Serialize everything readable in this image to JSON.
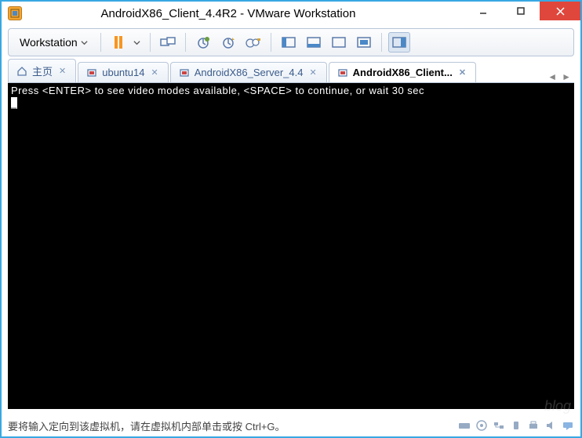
{
  "window": {
    "title": "AndroidX86_Client_4.4R2 - VMware Workstation"
  },
  "toolbar": {
    "menu_label": "Workstation"
  },
  "tabs": [
    {
      "label": "主页",
      "active": false,
      "icon": "home"
    },
    {
      "label": "ubuntu14",
      "active": false,
      "icon": "vm"
    },
    {
      "label": "AndroidX86_Server_4.4",
      "active": false,
      "icon": "vm"
    },
    {
      "label": "AndroidX86_Client...",
      "active": true,
      "icon": "vm"
    }
  ],
  "console": {
    "line1": "Press <ENTER> to see video modes available, <SPACE> to continue, or wait 30 sec",
    "cursor": "_"
  },
  "statusbar": {
    "message": "要将输入定向到该虚拟机，请在虚拟机内部单击或按 Ctrl+G。"
  },
  "watermark": "blog"
}
